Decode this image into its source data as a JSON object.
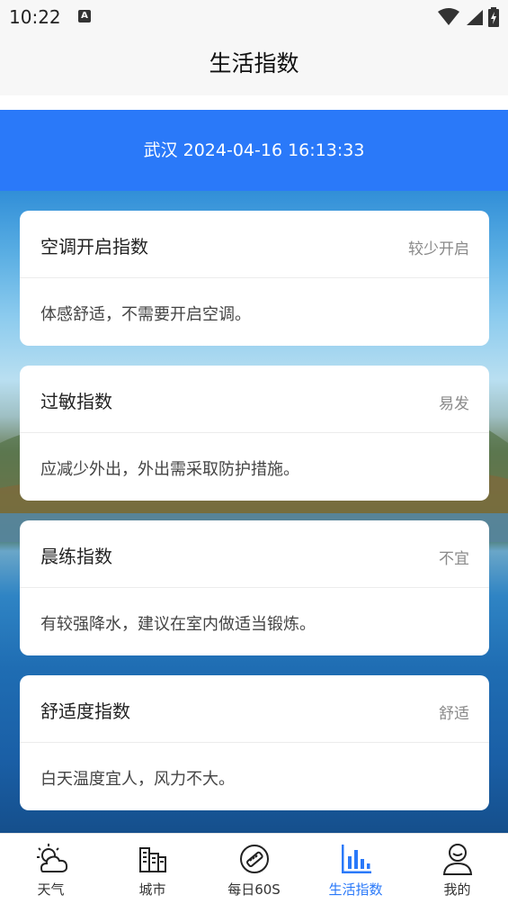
{
  "status_bar": {
    "time": "10:22",
    "badge": "A"
  },
  "header": {
    "title": "生活指数"
  },
  "banner": {
    "location_datetime": "武汉 2024-04-16 16:13:33"
  },
  "cards": [
    {
      "name": "空调开启指数",
      "level": "较少开启",
      "description": "体感舒适，不需要开启空调。"
    },
    {
      "name": "过敏指数",
      "level": "易发",
      "description": "应减少外出，外出需采取防护措施。"
    },
    {
      "name": "晨练指数",
      "level": "不宜",
      "description": "有较强降水，建议在室内做适当锻炼。"
    },
    {
      "name": "舒适度指数",
      "level": "舒适",
      "description": "白天温度宜人，风力不大。"
    }
  ],
  "nav": {
    "items": [
      {
        "label": "天气",
        "icon": "weather-icon"
      },
      {
        "label": "城市",
        "icon": "city-icon"
      },
      {
        "label": "每日60S",
        "icon": "daily-60s-icon"
      },
      {
        "label": "生活指数",
        "icon": "life-index-icon"
      },
      {
        "label": "我的",
        "icon": "profile-icon"
      }
    ],
    "active_index": 3
  },
  "colors": {
    "accent": "#2a79f9",
    "banner": "#2a79f9"
  }
}
